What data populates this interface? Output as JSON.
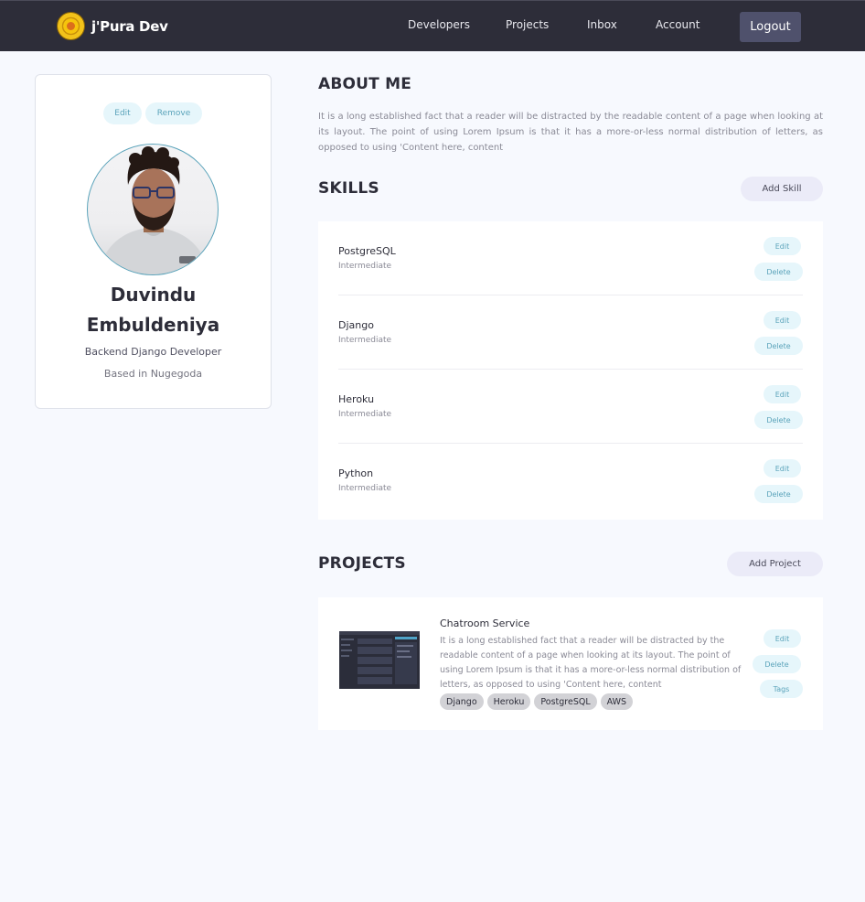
{
  "brand": {
    "name": "j'Pura Dev"
  },
  "nav": {
    "links": [
      "Developers",
      "Projects",
      "Inbox",
      "Account"
    ],
    "logout": "Logout"
  },
  "profile": {
    "edit": "Edit",
    "remove": "Remove",
    "first_name": "Duvindu",
    "last_name": "Embuldeniya",
    "role": "Backend Django Developer",
    "location": "Based in Nugegoda"
  },
  "about": {
    "heading": "ABOUT ME",
    "text": "It is a long established fact that a reader will be distracted by the readable content of a page when looking at its layout. The point of using Lorem Ipsum is that it has a more-or-less normal distribution of letters, as opposed to using 'Content here, content"
  },
  "skills": {
    "heading": "SKILLS",
    "add_label": "Add Skill",
    "edit_label": "Edit",
    "delete_label": "Delete",
    "items": [
      {
        "name": "PostgreSQL",
        "level": "Intermediate"
      },
      {
        "name": "Django",
        "level": "Intermediate"
      },
      {
        "name": "Heroku",
        "level": "Intermediate"
      },
      {
        "name": "Python",
        "level": "Intermediate"
      }
    ]
  },
  "projects": {
    "heading": "PROJECTS",
    "add_label": "Add Project",
    "edit_label": "Edit",
    "delete_label": "Delete",
    "tags_label": "Tags",
    "items": [
      {
        "title": "Chatroom Service",
        "description": "It is a long established fact that a reader will be distracted by the readable content of a page when looking at its layout. The point of using Lorem Ipsum is that it has a more-or-less normal distribution of letters, as opposed to using 'Content here, content",
        "tags": [
          "Django",
          "Heroku",
          "PostgreSQL",
          "AWS"
        ]
      }
    ]
  },
  "colors": {
    "nav_bg": "#2d2d39",
    "page_bg": "#f7f9fe",
    "accent_pill_bg": "#e6f6fb",
    "accent_pill_text": "#5aa3ba",
    "logout_bg": "#4f516c",
    "add_button_bg": "#ebebf8",
    "tag_bg": "#d2d2d6"
  }
}
